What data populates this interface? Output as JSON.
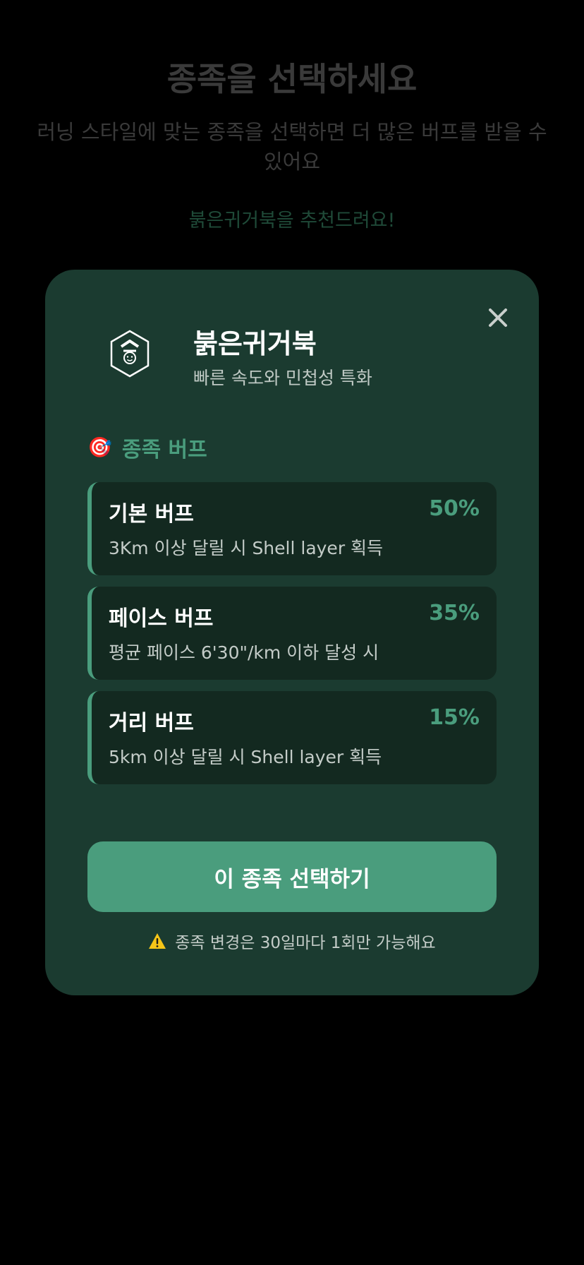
{
  "background": {
    "title": "종족을 선택하세요",
    "subtitle": "러닝 스타일에 맞는 종족을 선택하면 더 많은 버프를 받을 수 있어요",
    "recommendation": "붉은귀거북을 추천드려요!"
  },
  "modal": {
    "close_icon": "close-icon",
    "species_icon": "shell-badge-icon",
    "species_name": "붉은귀거북",
    "species_description": "빠른 속도와 민첩성 특화",
    "buff_section": {
      "icon": "🎯",
      "title": "종족 버프"
    },
    "buffs": [
      {
        "name": "기본 버프",
        "percent": "50%",
        "detail": "3Km 이상 달릴 시 Shell layer 획득"
      },
      {
        "name": "페이스 버프",
        "percent": "35%",
        "detail": "평균 페이스 6'30\"/km 이하 달성 시"
      },
      {
        "name": "거리 버프",
        "percent": "15%",
        "detail": "5km 이상 달릴 시 Shell layer 획득"
      }
    ],
    "select_button_label": "이 종족 선택하기",
    "notice_text": "종족 변경은 30일마다 1회만 가능해요",
    "notice_icon": "warning-icon"
  },
  "colors": {
    "accent": "#4a9d7d",
    "modal_background": "#1b3b30",
    "card_background": "#132920",
    "page_background": "#000000"
  }
}
